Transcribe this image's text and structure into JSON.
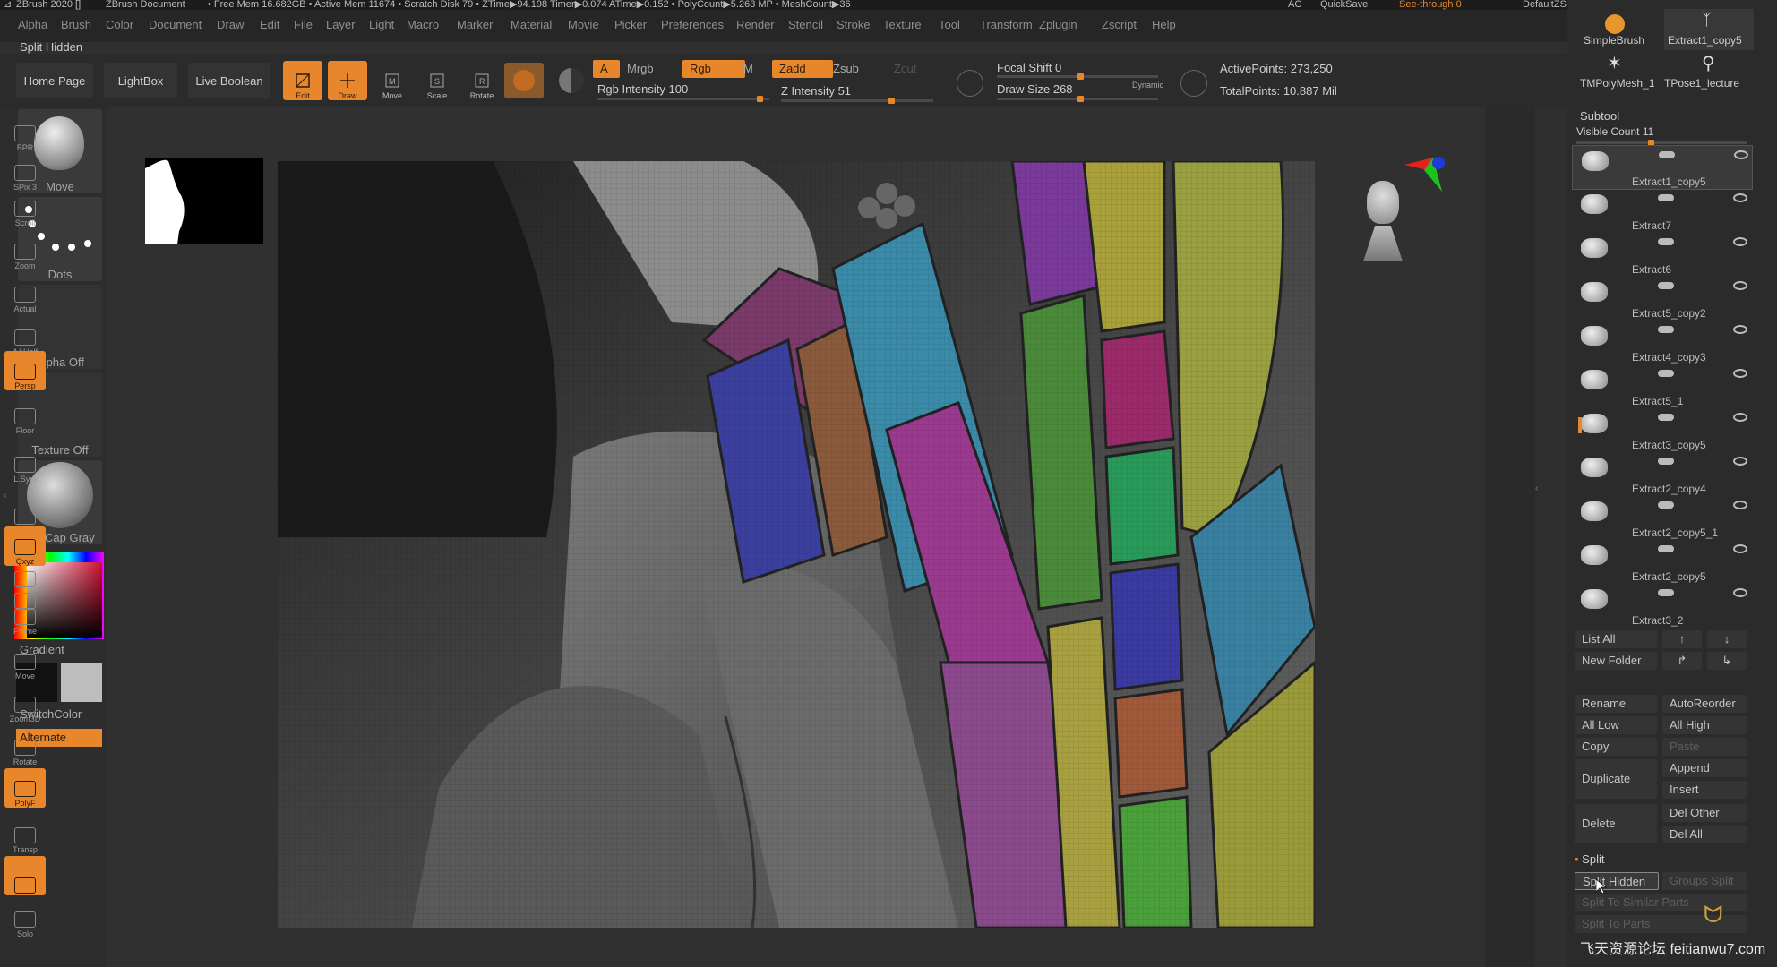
{
  "titlebar": {
    "app": "ZBrush 2020 []",
    "doc": "ZBrush Document",
    "stats": "• Free Mem 16.682GB • Active Mem 11674 • Scratch Disk 79 • ZTime▶94.198 Timer▶0.074 ATime▶0.152 • PolyCount▶5.263 MP • MeshCount▶36",
    "ac": "AC",
    "quicksave": "QuickSave",
    "seethrough": "See-through  0",
    "script": "DefaultZScript"
  },
  "menu": [
    "Alpha",
    "Brush",
    "Color",
    "Document",
    "Draw",
    "Edit",
    "File",
    "Layer",
    "Light",
    "Macro",
    "Marker",
    "Material",
    "Movie",
    "Picker",
    "Preferences",
    "Render",
    "Stencil",
    "Stroke",
    "Texture",
    "Tool",
    "Transform",
    "Zplugin",
    "Zscript",
    "Help"
  ],
  "subtitle": "Split Hidden",
  "toolbar": {
    "home": "Home Page",
    "lightbox": "LightBox",
    "liveboolean": "Live Boolean",
    "edit": "Edit",
    "draw": "Draw",
    "move": "Move",
    "scale": "Scale",
    "rotate": "Rotate",
    "a": "A",
    "mrgb": "Mrgb",
    "rgb": "Rgb",
    "m": "M",
    "zadd": "Zadd",
    "zsub": "Zsub",
    "zcut": "Zcut",
    "rgb_intensity": "Rgb Intensity 100",
    "z_intensity": "Z Intensity 51",
    "focal_shift": "Focal Shift 0",
    "draw_size": "Draw Size 268",
    "dynamic": "Dynamic",
    "active_points": "ActivePoints: 273,250",
    "total_points": "TotalPoints: 10.887 Mil"
  },
  "leftshelf": {
    "brush": "Move",
    "stroke": "Dots",
    "alpha": "Alpha Off",
    "texture": "Texture Off",
    "material": "MatCap Gray",
    "gradient": "Gradient",
    "switchcolor": "SwitchColor",
    "alternate": "Alternate"
  },
  "righttools": [
    "BPR",
    "SPix 3",
    "Scroll",
    "Zoom",
    "Actual",
    "AAHalf",
    "Persp",
    "Floor",
    "L.Sym",
    "",
    "Qxyz",
    "",
    "",
    "Frame",
    "Move",
    "Zoom3D",
    "Rotate",
    "PolyF",
    "Transp",
    "",
    "Solo"
  ],
  "toolpanel": {
    "simplebrush": "SimpleBrush",
    "extract_top": "Extract1_copy5",
    "tpolymesh": "TMPolyMesh_1",
    "tpose": "TPose1_lecture",
    "subtool_title": "Subtool",
    "visible_count": "Visible Count 11",
    "subtools": [
      "Extract1_copy5",
      "Extract7",
      "Extract6",
      "Extract5_copy2",
      "Extract4_copy3",
      "Extract5_1",
      "Extract3_copy5",
      "Extract2_copy4",
      "Extract2_copy5_1",
      "Extract2_copy5",
      "Extract3_2"
    ],
    "list_all": "List All",
    "new_folder": "New Folder",
    "rename": "Rename",
    "autoreorder": "AutoReorder",
    "all_low": "All Low",
    "all_high": "All High",
    "copy": "Copy",
    "paste": "Paste",
    "duplicate": "Duplicate",
    "append": "Append",
    "insert": "Insert",
    "delete": "Delete",
    "del_other": "Del Other",
    "del_all": "Del All",
    "split_title": "Split",
    "split_hidden": "Split Hidden",
    "groups_split": "Groups Split",
    "split_similar": "Split To Similar Parts",
    "split_parts": "Split To Parts"
  },
  "watermark": "飞天资源论坛 feitianwu7.com",
  "colors": {
    "accent": "#e8862c",
    "panel": "#2b2b2b",
    "canvas": "#303030"
  }
}
